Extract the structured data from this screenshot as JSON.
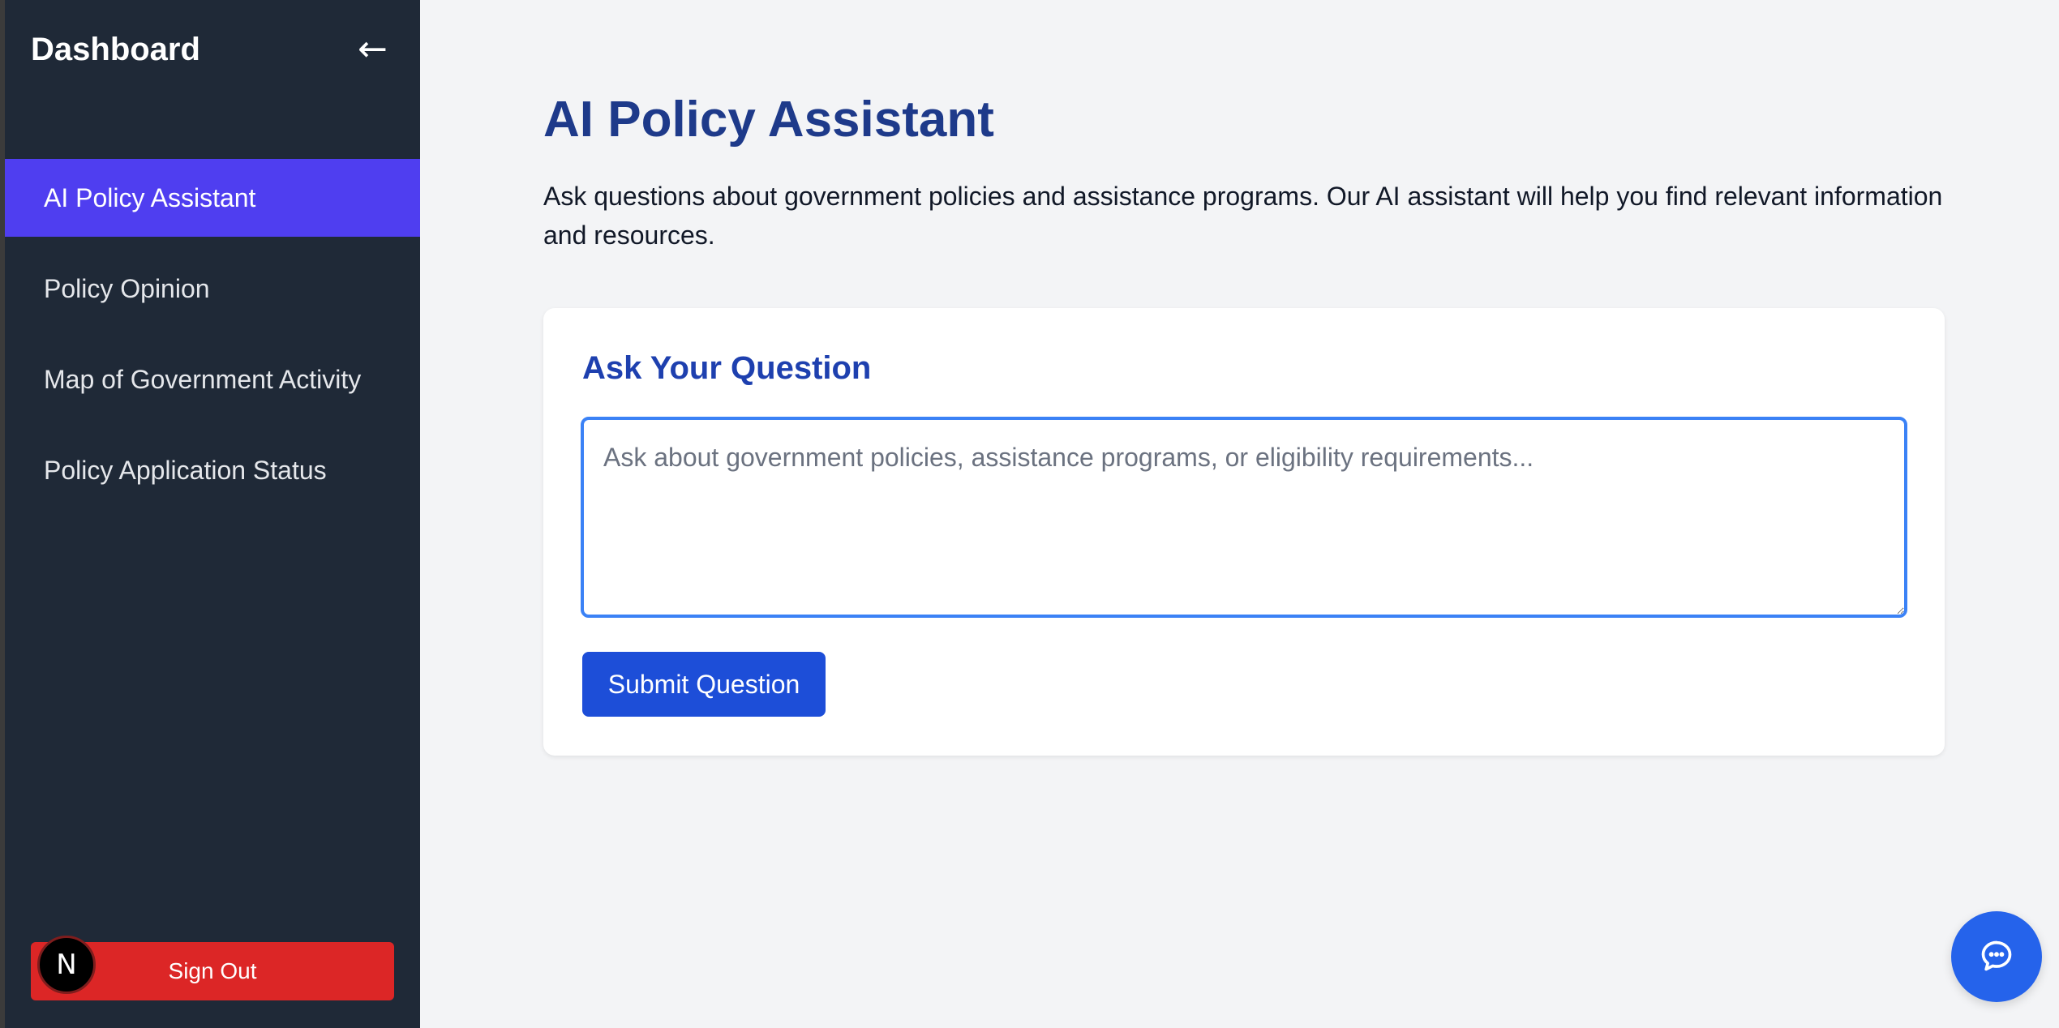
{
  "sidebar": {
    "title": "Dashboard",
    "collapse_icon": "←",
    "items": [
      {
        "label": "AI Policy Assistant",
        "active": true
      },
      {
        "label": "Policy Opinion",
        "active": false
      },
      {
        "label": "Map of Government Activity",
        "active": false
      },
      {
        "label": "Policy Application Status",
        "active": false
      }
    ],
    "sign_out_label": "Sign Out",
    "avatar_letter": "N"
  },
  "main": {
    "title": "AI Policy Assistant",
    "description": "Ask questions about government policies and assistance programs. Our AI assistant will help you find relevant information and resources.",
    "card": {
      "title": "Ask Your Question",
      "input_placeholder": "Ask about government policies, assistance programs, or eligibility requirements...",
      "input_value": "",
      "submit_label": "Submit Question"
    }
  },
  "chat_widget": {
    "icon": "chat-bubble-icon"
  },
  "colors": {
    "sidebar_bg": "#1f2937",
    "active_item": "#4f3ef0",
    "sign_out": "#dc2626",
    "title": "#1e3a8a",
    "primary_button": "#1d4ed8",
    "chat_button": "#2563eb"
  }
}
